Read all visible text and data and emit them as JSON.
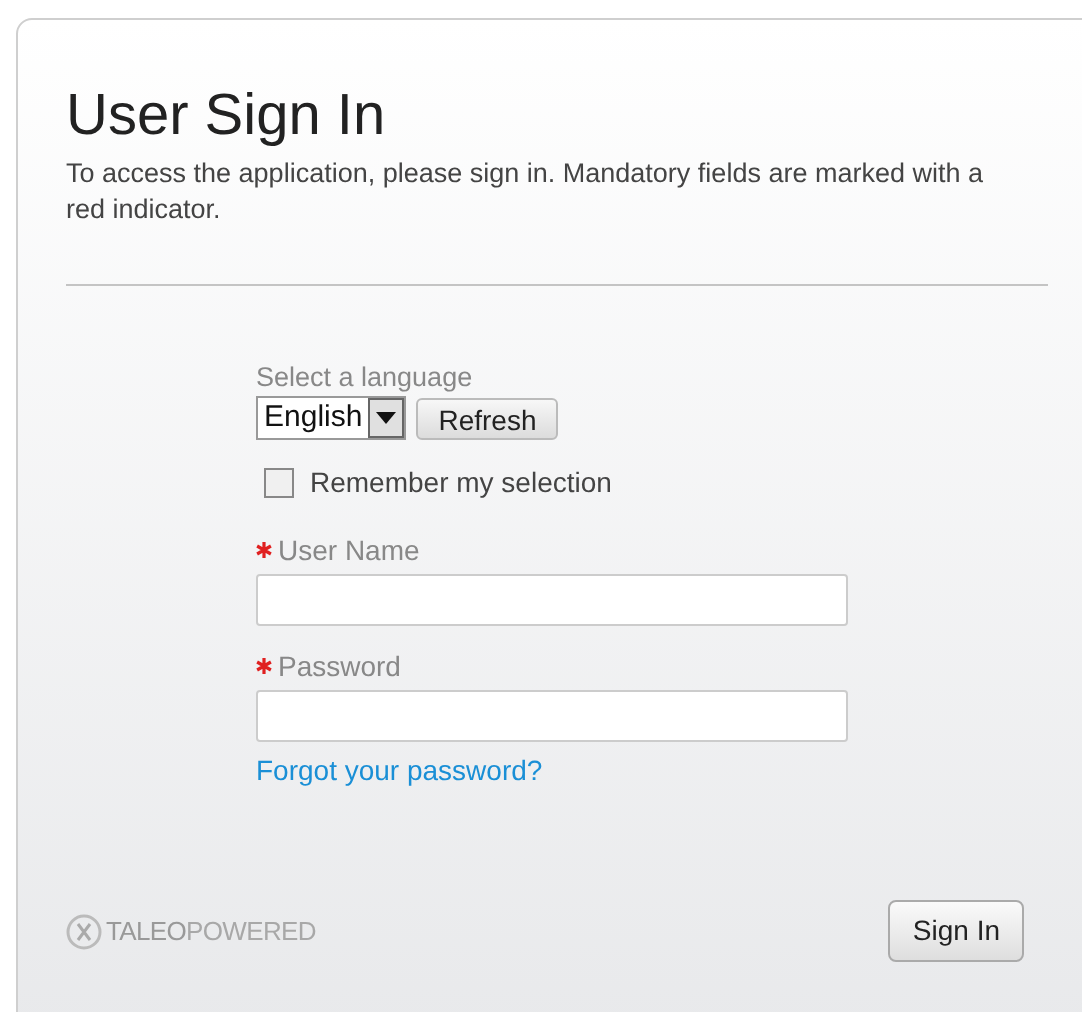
{
  "title": "User Sign In",
  "description": "To access the application, please sign in. Mandatory fields are marked with a red indicator.",
  "language": {
    "label": "Select a language",
    "value": "English",
    "refresh_button": "Refresh"
  },
  "remember": {
    "label": "Remember my selection",
    "checked": false
  },
  "fields": [
    {
      "label": "User Name",
      "required": true
    },
    {
      "label": "Password",
      "required": true
    }
  ],
  "forgot_link": "Forgot your password?",
  "footer": {
    "brand": "TALEO",
    "brand_suffix": "POWERED",
    "sign_in_button": "Sign In"
  }
}
